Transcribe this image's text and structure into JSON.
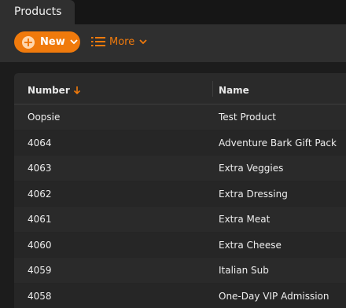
{
  "tab": {
    "label": "Products"
  },
  "toolbar": {
    "new_label": "New",
    "more_label": "More"
  },
  "table": {
    "columns": [
      "Number",
      "Name"
    ],
    "sort": {
      "column": "Number",
      "direction": "descending"
    },
    "rows": [
      {
        "number": "Oopsie",
        "name": "Test Product"
      },
      {
        "number": "4064",
        "name": "Adventure Bark Gift Pack"
      },
      {
        "number": "4063",
        "name": "Extra Veggies"
      },
      {
        "number": "4062",
        "name": "Extra Dressing"
      },
      {
        "number": "4061",
        "name": "Extra Meat"
      },
      {
        "number": "4060",
        "name": "Extra Cheese"
      },
      {
        "number": "4059",
        "name": "Italian Sub"
      },
      {
        "number": "4058",
        "name": "One-Day VIP Admission"
      }
    ]
  },
  "colors": {
    "accent": "#f07a0c",
    "background": "#1c1c1c",
    "panel": "#2a2a2a",
    "toolbar": "#2f2f2f"
  },
  "icons": {
    "new": "plus-circle-icon",
    "more": "list-icon",
    "sort": "arrow-down-icon"
  }
}
